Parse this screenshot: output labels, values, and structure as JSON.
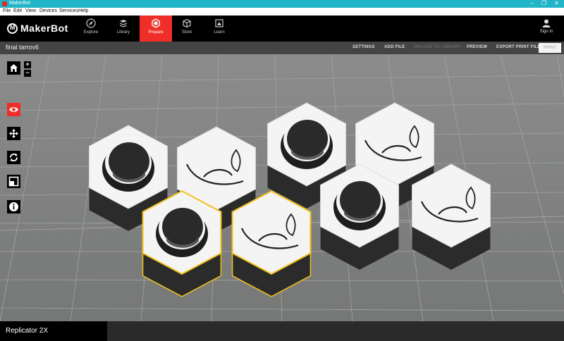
{
  "window": {
    "title": "MakerBot"
  },
  "menu": [
    "File",
    "Edit",
    "View",
    "Devices",
    "Services",
    "Help"
  ],
  "brand": {
    "name": "MakerBot"
  },
  "nav": {
    "tabs": [
      {
        "label": "Explore",
        "icon": "compass-icon"
      },
      {
        "label": "Library",
        "icon": "library-icon"
      },
      {
        "label": "Prepare",
        "icon": "prepare-icon",
        "active": true
      },
      {
        "label": "Store",
        "icon": "store-box-icon"
      },
      {
        "label": "Learn",
        "icon": "learn-icon"
      }
    ],
    "signin": "Sign In"
  },
  "file": {
    "name": "final tarrov6",
    "actions": [
      {
        "label": "SETTINGS",
        "enabled": true
      },
      {
        "label": "ADD FILE",
        "enabled": true
      },
      {
        "label": "UPLOAD TO LIBRARY",
        "enabled": false
      },
      {
        "label": "PREVIEW",
        "enabled": true
      },
      {
        "label": "EXPORT PRINT FILE",
        "enabled": true
      }
    ],
    "print": "PRINT"
  },
  "tools": [
    {
      "name": "home-view",
      "icon": "home-icon"
    },
    {
      "name": "look",
      "icon": "eye-icon",
      "active": true
    },
    {
      "name": "move",
      "icon": "move-arrows-icon"
    },
    {
      "name": "rotate",
      "icon": "rotate-icon"
    },
    {
      "name": "scale",
      "icon": "scale-icon"
    },
    {
      "name": "info",
      "icon": "info-icon"
    }
  ],
  "zoom": {
    "in": "+",
    "out": "−"
  },
  "printer": {
    "name": "Replicator 2X"
  },
  "scene": {
    "objects": [
      {
        "type": "hole",
        "selected": false
      },
      {
        "type": "leaf",
        "selected": false
      },
      {
        "type": "hole",
        "selected": false
      },
      {
        "type": "leaf",
        "selected": false
      },
      {
        "type": "hole",
        "selected": false
      },
      {
        "type": "leaf",
        "selected": false
      },
      {
        "type": "hole",
        "selected": true
      },
      {
        "type": "leaf",
        "selected": true
      }
    ],
    "selection_color": "#f2c21a"
  },
  "colors": {
    "accent": "#ef2e2a",
    "titlebar": "#21b5c7"
  }
}
